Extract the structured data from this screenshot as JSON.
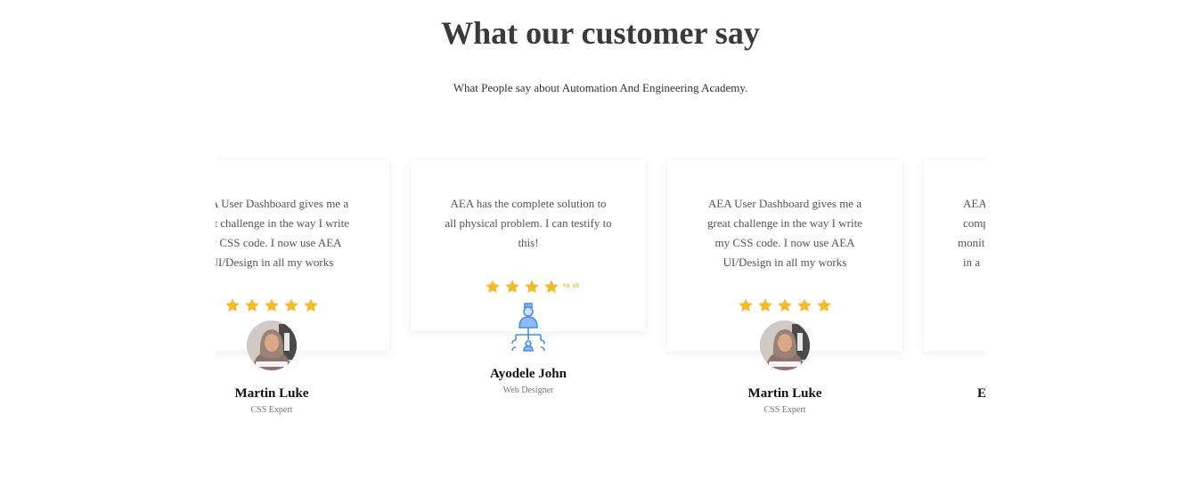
{
  "section": {
    "title": "What our customer say",
    "subtitle": "What People say about Automation And Engineering Academy."
  },
  "colors": {
    "star": "#f6b928",
    "icon_blue": "#4a8fe7"
  },
  "testimonials": [
    {
      "lines": [
        "AEA User Dashboard gives me a",
        "great challenge in the way I write",
        "my CSS code. I now use AEA",
        "UI/Design in all my works"
      ],
      "rating": 5,
      "name": "Martin Luke",
      "role": "CSS Expert",
      "image": "woman-in-hijab-avatar"
    },
    {
      "lines": [
        "AEA has the complete solution to",
        "all physical problem. I can testify to",
        "this!"
      ],
      "rating": 4,
      "broken_star_text": "F0 05",
      "name": "Ayodele John",
      "role": "Web Designer",
      "image": "team-hierarchy-icon"
    },
    {
      "lines": [
        "AEA User Dashboard gives me a",
        "great challenge in the way I write",
        "my CSS code. I now use AEA",
        "UI/Design in all my works"
      ],
      "rating": 5,
      "name": "Martin Luke",
      "role": "CSS Expert",
      "image": "woman-in-hijab-avatar"
    },
    {
      "lines": [
        "AEA",
        "comp",
        "monit",
        "in a"
      ],
      "name": "E"
    }
  ]
}
